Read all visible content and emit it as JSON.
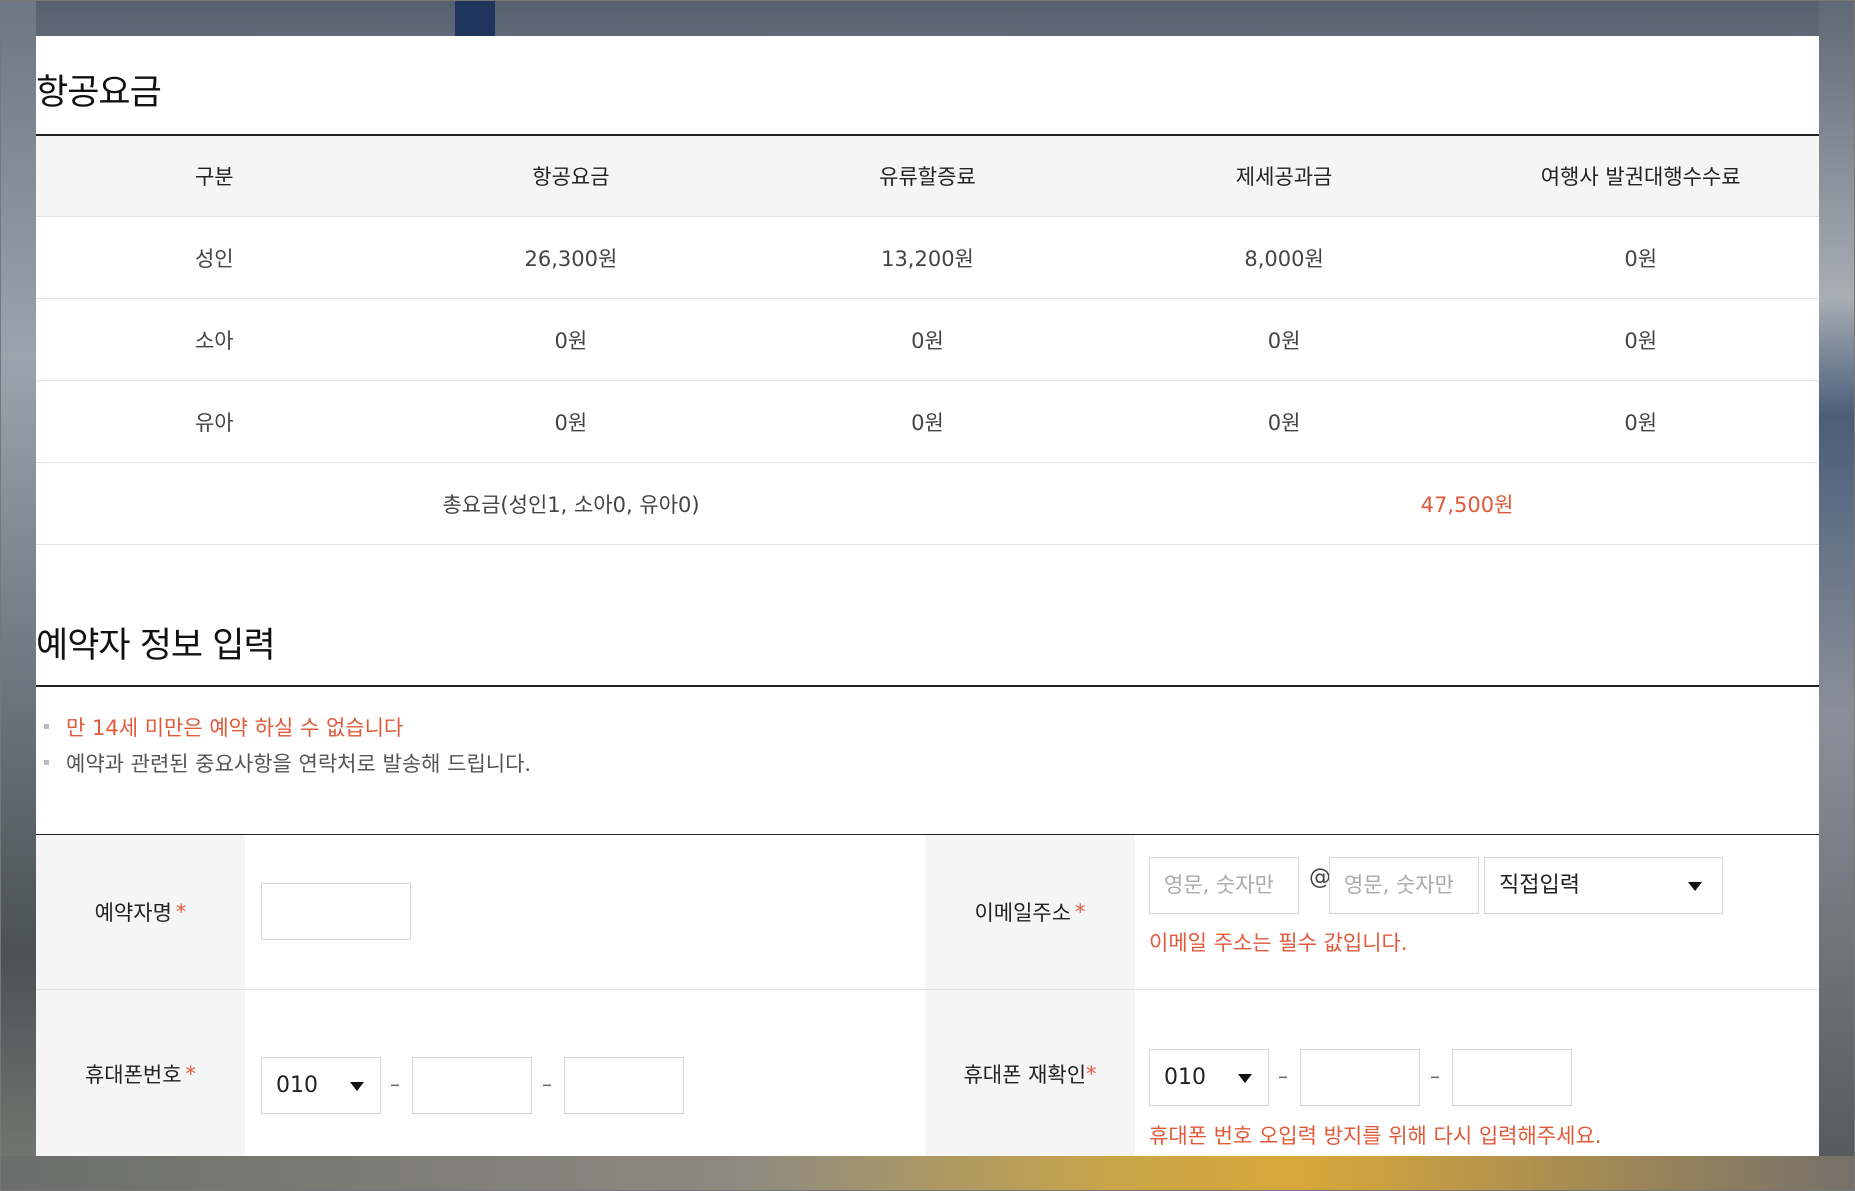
{
  "fare": {
    "title": "항공요금",
    "headers": [
      "구분",
      "항공요금",
      "유류할증료",
      "제세공과금",
      "여행사 발권대행수수료"
    ],
    "rows": [
      [
        "성인",
        "26,300원",
        "13,200원",
        "8,000원",
        "0원"
      ],
      [
        "소아",
        "0원",
        "0원",
        "0원",
        "0원"
      ],
      [
        "유아",
        "0원",
        "0원",
        "0원",
        "0원"
      ]
    ],
    "total_label": "총요금(성인1, 소아0, 유아0)",
    "total_value": "47,500원"
  },
  "booker": {
    "title": "예약자 정보 입력",
    "notices": [
      "만 14세 미만은 예약 하실 수 없습니다",
      "예약과 관련된 중요사항을 연락처로 발송해 드립니다."
    ],
    "name_label": "예약자명",
    "required_mark": "*",
    "email_label": "이메일주소",
    "email_placeholder_id": "영문, 숫자만",
    "email_at": "@",
    "email_placeholder_domain": "영문, 숫자만",
    "email_domain_select": "직접입력",
    "email_error": "이메일 주소는 필수 값입니다.",
    "phone_label": "휴대폰번호",
    "phone_prefix": "010",
    "phone_dash": "–",
    "phone_confirm_label": "휴대폰 재확인",
    "phone_confirm_prefix": "010",
    "phone_confirm_error": "휴대폰 번호 오입력 방지를 위해 다시 입력해주세요."
  },
  "colors": {
    "accent": "#e05a3a",
    "header_bg": "#f5f5f5",
    "rule": "#222222"
  }
}
